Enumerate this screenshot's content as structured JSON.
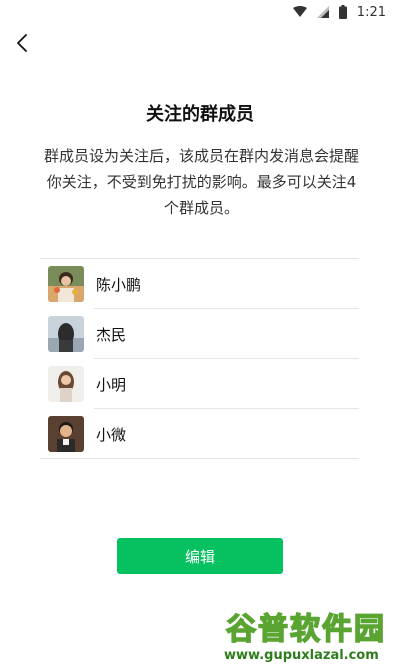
{
  "status_bar": {
    "time": "1:21",
    "icons": [
      "wifi-icon",
      "signal-icon",
      "battery-icon"
    ]
  },
  "header": {
    "back_icon": "back-arrow-icon"
  },
  "page": {
    "title": "关注的群成员",
    "description": "群成员设为关注后，该成员在群内发消息会提醒你关注，不受到免打扰的影响。最多可以关注4个群成员。"
  },
  "members": [
    {
      "name": "陈小鹏"
    },
    {
      "name": "杰民"
    },
    {
      "name": "小明"
    },
    {
      "name": "小微"
    }
  ],
  "actions": {
    "edit_label": "编辑"
  },
  "watermark": {
    "title": "谷普软件园",
    "url": "www.gupuxlazal.com"
  },
  "colors": {
    "accent": "#07c160",
    "divider": "#e5e5e5",
    "watermark": "#5aa532"
  }
}
